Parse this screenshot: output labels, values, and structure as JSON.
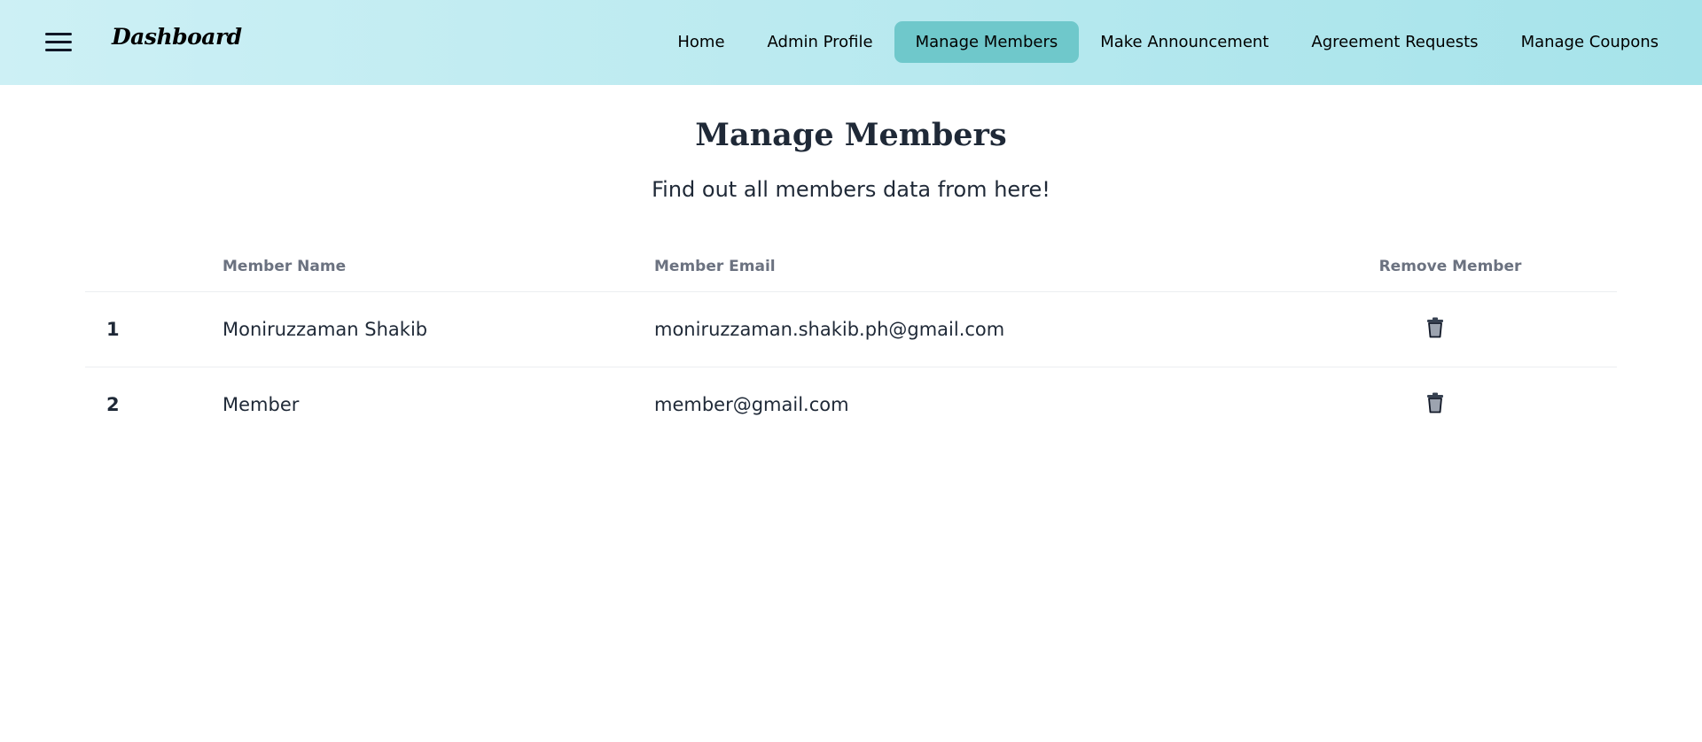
{
  "header": {
    "brand": "Dashboard",
    "nav": [
      {
        "label": "Home",
        "active": false
      },
      {
        "label": "Admin Profile",
        "active": false
      },
      {
        "label": "Manage Members",
        "active": true
      },
      {
        "label": "Make Announcement",
        "active": false
      },
      {
        "label": "Agreement Requests",
        "active": false
      },
      {
        "label": "Manage Coupons",
        "active": false
      }
    ],
    "icons": {
      "menu": "hamburger-icon"
    }
  },
  "main": {
    "title": "Manage Members",
    "subtitle": "Find out all members data from here!",
    "table": {
      "columns": [
        "",
        "Member Name",
        "Member Email",
        "Remove Member"
      ],
      "rows": [
        {
          "index": "1",
          "name": "Moniruzzaman Shakib",
          "email": "moniruzzaman.shakib.ph@gmail.com",
          "action_icon": "trash-icon"
        },
        {
          "index": "2",
          "name": "Member",
          "email": "member@gmail.com",
          "action_icon": "trash-icon"
        }
      ]
    }
  },
  "colors": {
    "header_gradient_start": "#cdf0f5",
    "header_gradient_end": "#a6e3ea",
    "active_tab": "#6fc8cb",
    "text": "#1f2937",
    "muted": "#6b7280"
  }
}
